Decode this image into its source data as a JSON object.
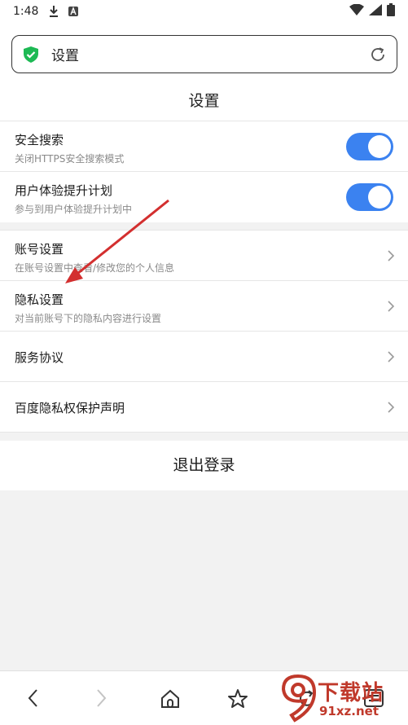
{
  "status_bar": {
    "time": "1:48"
  },
  "address_bar": {
    "text": "设置"
  },
  "page": {
    "title": "设置"
  },
  "settings": [
    {
      "title": "安全搜索",
      "subtitle": "关闭HTTPS安全搜索模式",
      "toggle_on": true
    },
    {
      "title": "用户体验提升计划",
      "subtitle": "参与到用户体验提升计划中",
      "toggle_on": true
    },
    {
      "title": "账号设置",
      "subtitle": "在账号设置中查看/修改您的个人信息"
    },
    {
      "title": "隐私设置",
      "subtitle": "对当前账号下的隐私内容进行设置"
    },
    {
      "title": "服务协议"
    },
    {
      "title": "百度隐私权保护声明"
    }
  ],
  "logout": {
    "label": "退出登录"
  },
  "watermark": {
    "brand": "下载站",
    "url": "91xz.net"
  },
  "colors": {
    "toggle_on": "#3b82f0",
    "shield": "#1db954",
    "annotation_arrow": "#d32f2f",
    "watermark": "#c0392b"
  }
}
